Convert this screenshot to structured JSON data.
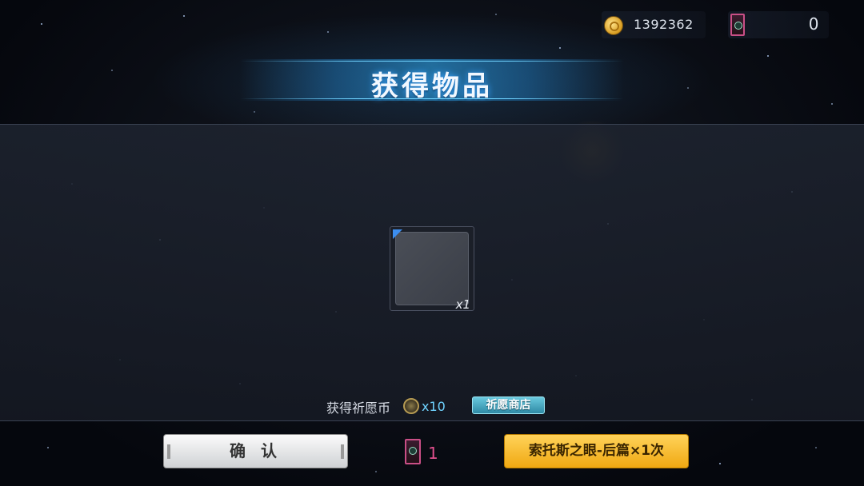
{
  "header": {
    "gold_amount": "1392362",
    "ticket_amount": "0",
    "title": "获得物品"
  },
  "reward": {
    "item_quantity": "x1",
    "label": "获得祈愿币",
    "coin_quantity": "x10",
    "shop_button": "祈愿商店"
  },
  "footer": {
    "confirm_button": "确 认",
    "ticket_count": "1",
    "draw_button": "索托斯之眼-后篇×1次"
  },
  "colors": {
    "accent_blue": "#6fd3ff",
    "gold_button": "#f0a812",
    "ticket_pink": "#e0508e"
  },
  "icons": {
    "gold": "gold-coin-icon",
    "ticket": "wish-ticket-icon",
    "medal": "wish-coin-icon"
  }
}
